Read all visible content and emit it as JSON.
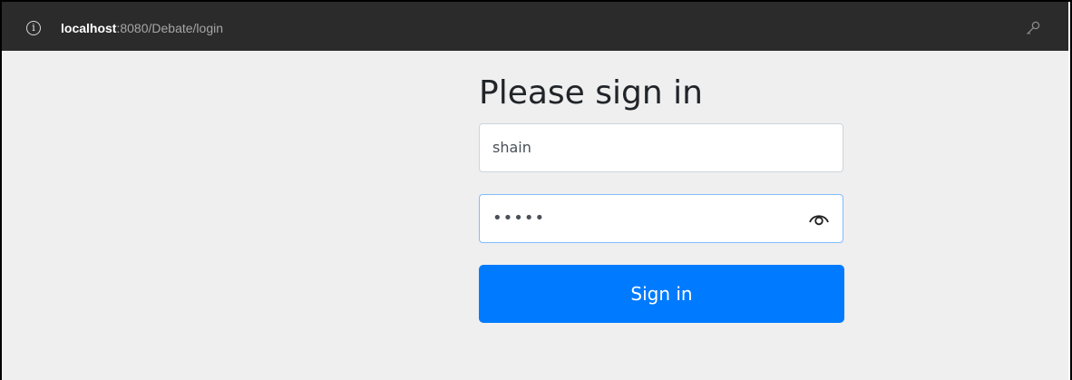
{
  "browser": {
    "url_host": "localhost",
    "url_path": ":8080/Debate/login",
    "info_icon": "info-icon",
    "key_icon": "key-icon"
  },
  "login": {
    "heading": "Please sign in",
    "username_value": "shain",
    "password_mask": "•••••",
    "reveal_icon": "eye-icon",
    "submit_label": "Sign in"
  },
  "colors": {
    "addressbar_bg": "#2b2b2b",
    "page_bg": "#efefef",
    "primary_button": "#007bff",
    "focused_border": "#80bdff"
  }
}
